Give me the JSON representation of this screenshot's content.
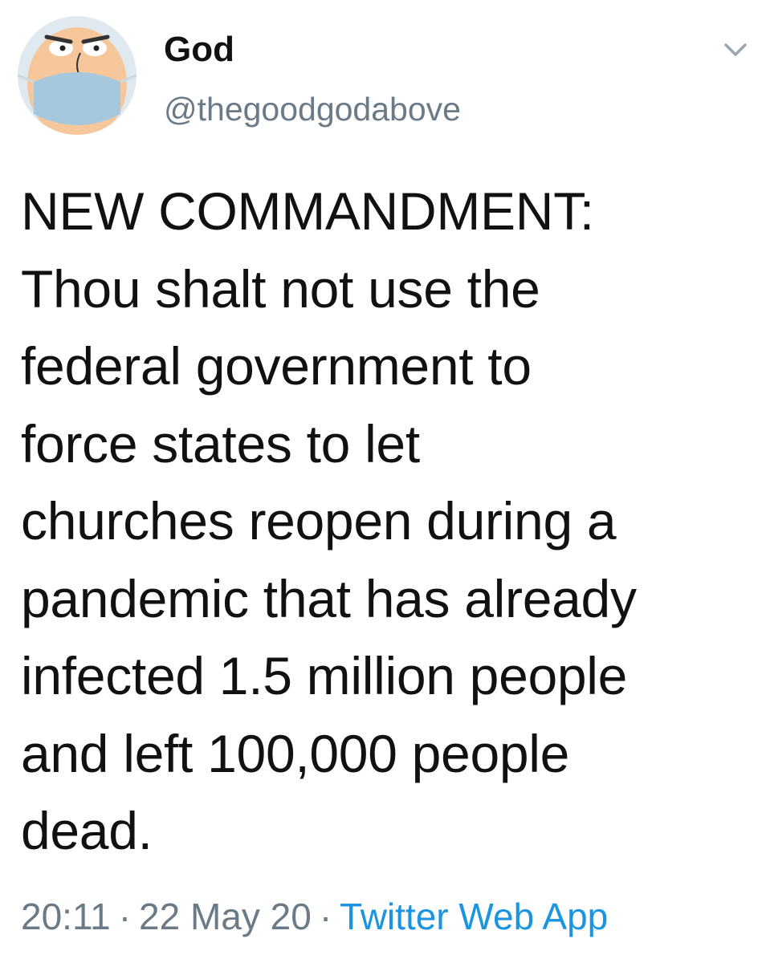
{
  "author": {
    "display_name": "God",
    "handle": "@thegoodgodabove",
    "avatar_icon": "masked-face-avatar-icon"
  },
  "menu": {
    "icon": "chevron-down-icon"
  },
  "tweet": {
    "text": "NEW COMMANDMENT:\nThou shalt not use the\nfederal government to\nforce states to let\nchurches reopen during a\npandemic that has already\ninfected 1.5 million people\nand left 100,000 people\ndead.",
    "time": "20:11",
    "separator": "·",
    "date": "22 May 20",
    "source": "Twitter Web App"
  },
  "colors": {
    "text": "#111111",
    "secondary": "#6a7a86",
    "link": "#1b95e0",
    "avatar_bg": "#dfe9ef",
    "avatar_face": "#f5c79a",
    "avatar_mask": "#a6c8df"
  }
}
